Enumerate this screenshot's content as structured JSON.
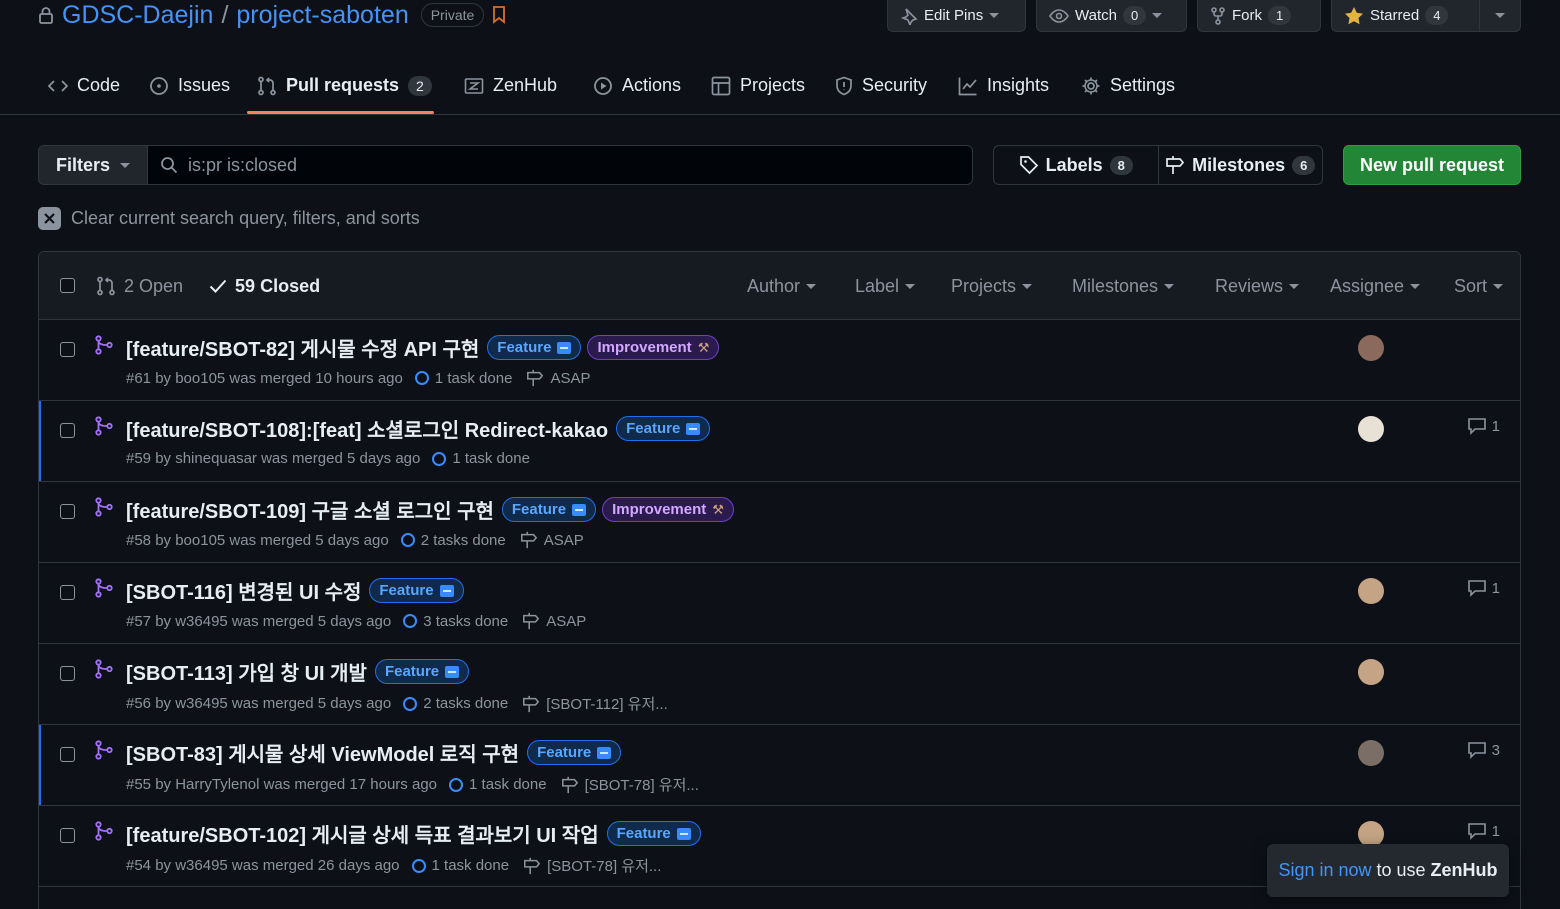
{
  "repo": {
    "owner": "GDSC-Daejin",
    "separator": "/",
    "name": "project-saboten",
    "visibility": "Private"
  },
  "header_actions": {
    "edit_pins": "Edit Pins",
    "watch": "Watch",
    "watch_count": "0",
    "fork": "Fork",
    "fork_count": "1",
    "starred": "Starred",
    "star_count": "4"
  },
  "nav": {
    "code": "Code",
    "issues": "Issues",
    "pull_requests": "Pull requests",
    "pull_requests_count": "2",
    "zenhub": "ZenHub",
    "actions": "Actions",
    "projects": "Projects",
    "security": "Security",
    "insights": "Insights",
    "settings": "Settings"
  },
  "filter_bar": {
    "filters_label": "Filters",
    "search_value": "is:pr is:closed",
    "labels_label": "Labels",
    "labels_count": "8",
    "milestones_label": "Milestones",
    "milestones_count": "6",
    "new_pr_label": "New pull request",
    "clear_query": "Clear current search query, filters, and sorts"
  },
  "list_header": {
    "open": "2 Open",
    "closed": "59 Closed",
    "author": "Author",
    "label": "Label",
    "projects": "Projects",
    "milestones": "Milestones",
    "reviews": "Reviews",
    "assignee": "Assignee",
    "sort": "Sort"
  },
  "pull_requests": [
    {
      "title": "[feature/SBOT-82] 게시물 수정 API 구현",
      "labels": [
        "Feature",
        "Improvement"
      ],
      "meta": "#61 by boo105 was merged 10 hours ago",
      "tasks": "1 task done",
      "milestone": "ASAP",
      "comments": "",
      "avatar_color": "#8a6a5c",
      "highlight": false
    },
    {
      "title": "[feature/SBOT-108]:[feat] 소셜로그인 Redirect-kakao",
      "labels": [
        "Feature"
      ],
      "meta": "#59 by shinequasar was merged 5 days ago",
      "tasks": "1 task done",
      "milestone": "",
      "comments": "1",
      "avatar_color": "#e8e2d6",
      "highlight": true
    },
    {
      "title": "[feature/SBOT-109] 구글 소셜 로그인 구현",
      "labels": [
        "Feature",
        "Improvement"
      ],
      "meta": "#58 by boo105 was merged 5 days ago",
      "tasks": "2 tasks done",
      "milestone": "ASAP",
      "comments": "",
      "avatar_color": "",
      "highlight": false
    },
    {
      "title": "[SBOT-116] 변경된 UI 수정",
      "labels": [
        "Feature"
      ],
      "meta": "#57 by w36495 was merged 5 days ago",
      "tasks": "3 tasks done",
      "milestone": "ASAP",
      "comments": "1",
      "avatar_color": "#c4a484",
      "highlight": false
    },
    {
      "title": "[SBOT-113] 가입 창 UI 개발",
      "labels": [
        "Feature"
      ],
      "meta": "#56 by w36495 was merged 5 days ago",
      "tasks": "2 tasks done",
      "milestone": "[SBOT-112] 유저...",
      "comments": "",
      "avatar_color": "#c4a484",
      "highlight": false
    },
    {
      "title": "[SBOT-83] 게시물 상세 ViewModel 로직 구현",
      "labels": [
        "Feature"
      ],
      "meta": "#55 by HarryTylenol was merged 17 hours ago",
      "tasks": "1 task done",
      "milestone": "[SBOT-78] 유저...",
      "comments": "3",
      "avatar_color": "#7a6e66",
      "highlight": true
    },
    {
      "title": "[feature/SBOT-102] 게시글 상세 득표 결과보기 UI 작업",
      "labels": [
        "Feature"
      ],
      "meta": "#54 by w36495 was merged 26 days ago",
      "tasks": "1 task done",
      "milestone": "[SBOT-78] 유저...",
      "comments": "1",
      "avatar_color": "#c4a484",
      "highlight": false
    }
  ],
  "zenhub_toast": {
    "link": "Sign in now",
    "middle": " to use ",
    "brand": "ZenHub"
  },
  "colors": {
    "background": "#0d1117",
    "accent_blue": "#4493f8",
    "merged_purple": "#a371f7",
    "primary_green": "#238636",
    "nav_underline": "#f78166"
  }
}
